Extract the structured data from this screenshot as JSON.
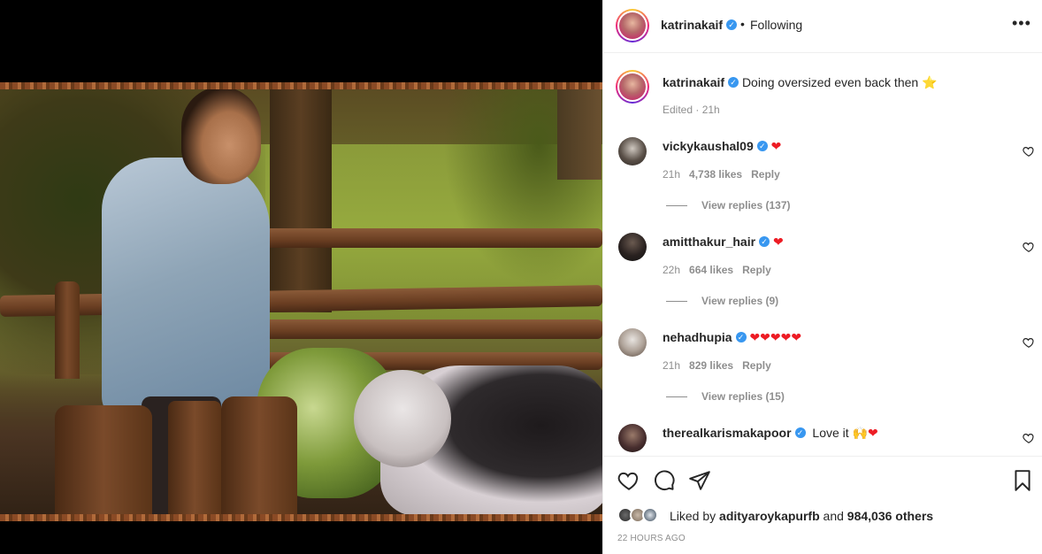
{
  "post": {
    "author": "katrinakaif",
    "follow_state": "Following",
    "dot": "•",
    "more_icon": "more-horizontal-icon",
    "caption": "Doing oversized even back then",
    "caption_emoji": "⭐",
    "caption_meta": "Edited · 21h"
  },
  "comments": [
    {
      "user": "vickykaushal09",
      "verified": true,
      "text": "",
      "emoji": "❤",
      "time": "21h",
      "likes": "4,738 likes",
      "reply": "Reply",
      "view_replies": "View replies (137)"
    },
    {
      "user": "amitthakur_hair",
      "verified": true,
      "text": "",
      "emoji": "❤",
      "time": "22h",
      "likes": "664 likes",
      "reply": "Reply",
      "view_replies": "View replies (9)"
    },
    {
      "user": "nehadhupia",
      "verified": true,
      "text": "",
      "emoji": "❤❤❤❤❤",
      "time": "21h",
      "likes": "829 likes",
      "reply": "Reply",
      "view_replies": "View replies (15)"
    },
    {
      "user": "therealkarismakapoor",
      "verified": true,
      "text": "Love it",
      "emoji": "🙌❤",
      "time": "",
      "likes": "",
      "reply": "",
      "view_replies": ""
    }
  ],
  "footer": {
    "liked_prefix": "Liked by",
    "liked_user": "adityaroykapurfb",
    "liked_and": "and",
    "liked_others": "984,036 others",
    "time_ago": "22 HOURS AGO"
  },
  "colors": {
    "verified": "#3897f0",
    "heart": "#ed1c24",
    "muted": "#8e8e8e",
    "text": "#262626"
  }
}
